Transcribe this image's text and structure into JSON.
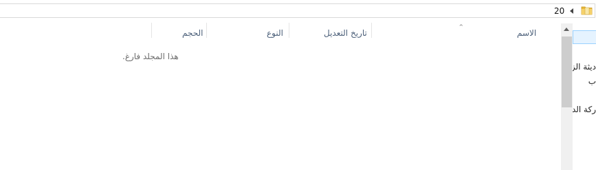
{
  "address_bar": {
    "breadcrumb": "20"
  },
  "columns": [
    {
      "label": "الاسم"
    },
    {
      "label": "تاريخ التعديل"
    },
    {
      "label": "النوع"
    },
    {
      "label": "الحجم"
    }
  ],
  "content": {
    "empty_message": "هذا المجلد فارغ."
  },
  "nav_pane": {
    "items": [
      {
        "label": "ديثة الز"
      },
      {
        "label": "ب"
      },
      {
        "label": "ركة الد"
      }
    ]
  },
  "colors": {
    "header_text": "#4c607a",
    "selection_bg": "#e5f3ff",
    "selection_border": "#99d1ff",
    "folder_yellow": "#e8b83a"
  },
  "icons": [
    "folder-icon",
    "chevron-left-icon",
    "sort-up-icon",
    "scroll-up-icon"
  ]
}
